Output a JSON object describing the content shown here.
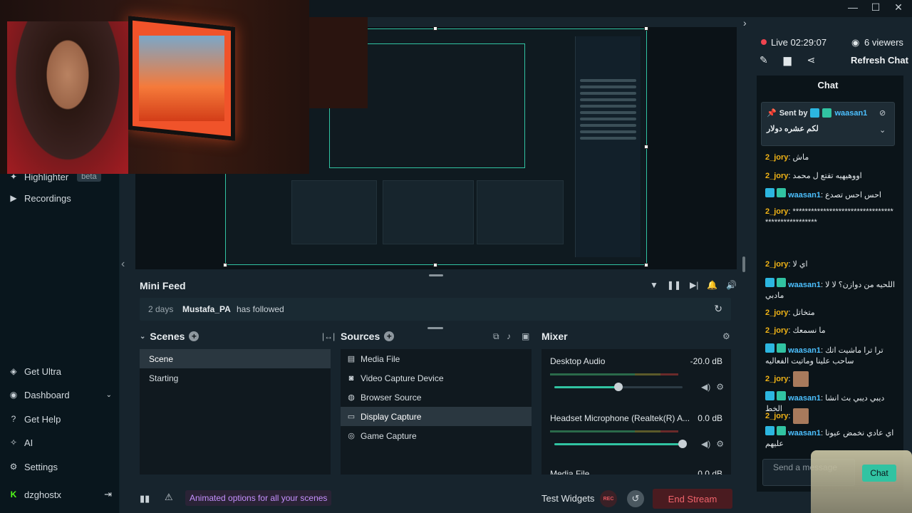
{
  "window": {
    "controls": [
      "minimize",
      "maximize",
      "close"
    ]
  },
  "sidebar": {
    "items": [
      {
        "label": "Highlighter",
        "badge": "beta",
        "icon": "highlighter-icon"
      },
      {
        "label": "Recordings",
        "icon": "play-circle-icon"
      },
      {
        "label": "Get Ultra",
        "icon": "ultra-icon"
      },
      {
        "label": "Dashboard",
        "icon": "dashboard-icon"
      },
      {
        "label": "Get Help",
        "icon": "help-icon"
      },
      {
        "label": "AI",
        "icon": "sparkle-icon"
      },
      {
        "label": "Settings",
        "icon": "gear-icon"
      },
      {
        "label": "dzghostx",
        "icon": "kick-icon"
      }
    ]
  },
  "mini_feed": {
    "title": "Mini Feed",
    "event": {
      "time": "2 days",
      "user": "Mustafa_PA",
      "action": "has followed"
    }
  },
  "scenes": {
    "title": "Scenes",
    "items": [
      {
        "label": "Scene",
        "active": true
      },
      {
        "label": "Starting",
        "active": false
      }
    ]
  },
  "sources": {
    "title": "Sources",
    "items": [
      {
        "label": "Media File",
        "icon": "media-file-icon",
        "active": false
      },
      {
        "label": "Video Capture Device",
        "icon": "camera-icon",
        "active": false
      },
      {
        "label": "Browser Source",
        "icon": "globe-icon",
        "active": false
      },
      {
        "label": "Display Capture",
        "icon": "monitor-icon",
        "active": true
      },
      {
        "label": "Game Capture",
        "icon": "gamepad-icon",
        "active": false
      }
    ]
  },
  "mixer": {
    "title": "Mixer",
    "channels": [
      {
        "name": "Desktop Audio",
        "db": "-20.0 dB",
        "level": 0.5
      },
      {
        "name": "Headset Microphone (Realtek(R) A...",
        "db": "0.0 dB",
        "level": 1.0
      },
      {
        "name": "Media File",
        "db": "0.0 dB",
        "level": 1.0
      }
    ]
  },
  "footer": {
    "promo": "Animated options for all your scenes",
    "test_widgets": "Test Widgets",
    "rec": "REC",
    "end_stream": "End Stream"
  },
  "chat": {
    "live": "Live 02:29:07",
    "viewers": "6 viewers",
    "refresh": "Refresh Chat",
    "title": "Chat",
    "pinned": {
      "by_label": "Sent by",
      "user": "waasan1",
      "message": "لكم عشره دولار"
    },
    "messages": [
      {
        "user": "2_jory",
        "text": "ماش"
      },
      {
        "user": "2_jory",
        "text": "اووهيهيه تقتع ل محمد"
      },
      {
        "user": "waasan1",
        "text": "احس احس تصدع"
      },
      {
        "user": "2_jory",
        "text": "**************************************************"
      },
      {
        "user": "2_jory",
        "text": "اي لا"
      },
      {
        "user": "waasan1",
        "text": "اللحيه من دوازن؟ لا لا مادبي"
      },
      {
        "user": "2_jory",
        "text": "متخاتل"
      },
      {
        "user": "2_jory",
        "text": "ما نسمعك"
      },
      {
        "user": "waasan1",
        "text": "ترا ترا ماشيت اتك ساحب علينا وماتيت الفعاليه"
      },
      {
        "user": "2_jory",
        "text": ""
      },
      {
        "user": "waasan1",
        "text": "ديبي ديبي بث انشا الخط"
      },
      {
        "user": "2_jory",
        "text": ""
      },
      {
        "user": "waasan1",
        "text": "اي عادي نخمض عيونا عليهم"
      }
    ],
    "input_placeholder": "Send a message",
    "send_label": "Chat"
  },
  "colors": {
    "accent": "#31c3a2",
    "live": "#f0444f",
    "end_stream": "#f2646c",
    "promo": "#c590ff"
  }
}
